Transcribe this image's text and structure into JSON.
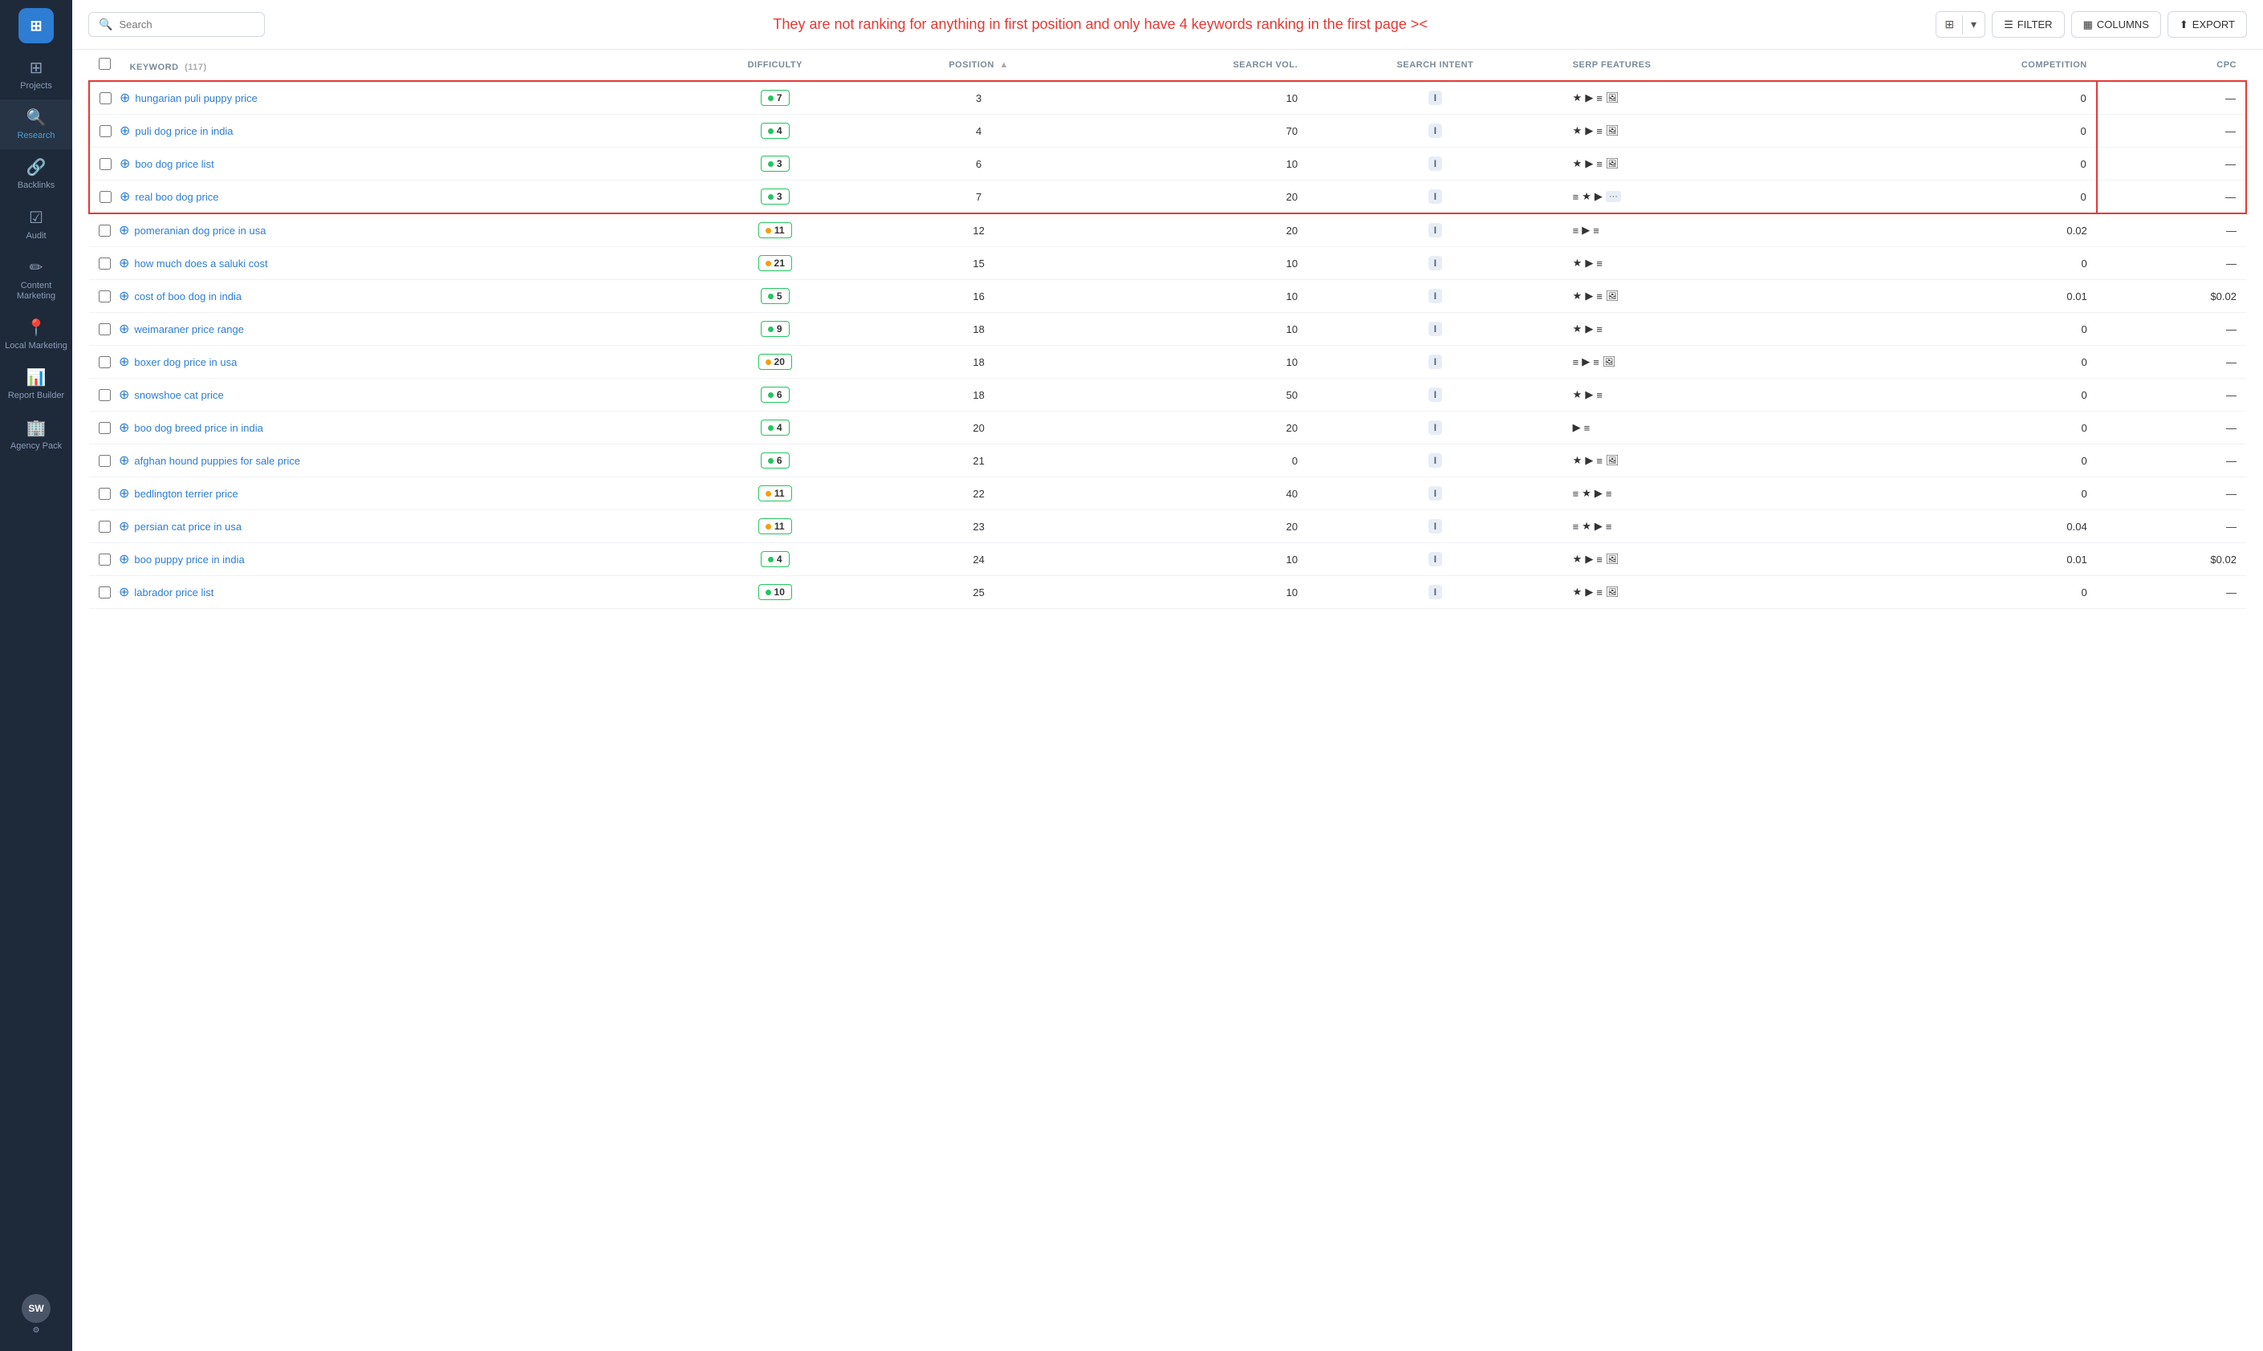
{
  "sidebar": {
    "logo": "⊞",
    "items": [
      {
        "id": "projects",
        "label": "Projects",
        "icon": "⊞",
        "active": false
      },
      {
        "id": "research",
        "label": "Research",
        "icon": "🔍",
        "active": true
      },
      {
        "id": "backlinks",
        "label": "Backlinks",
        "icon": "🔗",
        "active": false
      },
      {
        "id": "audit",
        "label": "Audit",
        "icon": "☑",
        "active": false
      },
      {
        "id": "content-marketing",
        "label": "Content Marketing",
        "icon": "✏",
        "active": false
      },
      {
        "id": "local-marketing",
        "label": "Local Marketing",
        "icon": "📍",
        "active": false
      },
      {
        "id": "report-builder",
        "label": "Report Builder",
        "icon": "📊",
        "active": false
      },
      {
        "id": "agency-pack",
        "label": "Agency Pack",
        "icon": "🏢",
        "active": false
      }
    ],
    "avatar": "SW"
  },
  "toolbar": {
    "search_placeholder": "Search",
    "annotation": "They are not ranking for anything in first position and only have 4 keywords ranking in the first page ><",
    "filter_label": "FILTER",
    "columns_label": "COLUMNS",
    "export_label": "EXPORT"
  },
  "table": {
    "header": {
      "select_all": "",
      "keyword_col": "KEYWORD",
      "keyword_count": "117",
      "difficulty_col": "DIFFICULTY",
      "position_col": "POSITION",
      "search_vol_col": "SEARCH VOL.",
      "search_intent_col": "SEARCH INTENT",
      "serp_features_col": "SERP FEATURES",
      "competition_col": "COMPETITION",
      "cpc_col": "CPC"
    },
    "rows": [
      {
        "id": 1,
        "keyword": "hungarian puli puppy price",
        "difficulty": 7,
        "diff_color": "green",
        "position": 3,
        "search_vol": 10,
        "intent": "I",
        "serp": [
          "★",
          "▶",
          "≡",
          "🖼"
        ],
        "competition": 0,
        "cpc": "—",
        "highlighted": true
      },
      {
        "id": 2,
        "keyword": "puli dog price in india",
        "difficulty": 4,
        "diff_color": "green",
        "position": 4,
        "search_vol": 70,
        "intent": "I",
        "serp": [
          "★",
          "▶",
          "≡",
          "🖼"
        ],
        "competition": 0,
        "cpc": "—",
        "highlighted": true
      },
      {
        "id": 3,
        "keyword": "boo dog price list",
        "difficulty": 3,
        "diff_color": "green",
        "position": 6,
        "search_vol": 10,
        "intent": "I",
        "serp": [
          "★",
          "▶",
          "≡",
          "🖼"
        ],
        "competition": 0,
        "cpc": "—",
        "highlighted": true
      },
      {
        "id": 4,
        "keyword": "real boo dog price",
        "difficulty": 3,
        "diff_color": "green",
        "position": 7,
        "search_vol": 20,
        "intent": "I",
        "serp": [
          "≡",
          "★",
          "▶",
          "···"
        ],
        "competition": 0,
        "cpc": "—",
        "highlighted": true
      },
      {
        "id": 5,
        "keyword": "pomeranian dog price in usa",
        "difficulty": 11,
        "diff_color": "green",
        "position": 12,
        "search_vol": 20,
        "intent": "I",
        "serp": [
          "≡",
          "▶",
          "≡"
        ],
        "competition": 0.02,
        "cpc": "—",
        "highlighted": false
      },
      {
        "id": 6,
        "keyword": "how much does a saluki cost",
        "difficulty": 21,
        "diff_color": "yellow",
        "position": 15,
        "search_vol": 10,
        "intent": "I",
        "serp": [
          "★",
          "▶",
          "≡"
        ],
        "competition": 0,
        "cpc": "—",
        "highlighted": false
      },
      {
        "id": 7,
        "keyword": "cost of boo dog in india",
        "difficulty": 5,
        "diff_color": "green",
        "position": 16,
        "search_vol": 10,
        "intent": "I",
        "serp": [
          "★",
          "▶",
          "≡",
          "🖼"
        ],
        "competition": 0.01,
        "cpc": "$0.02",
        "highlighted": false
      },
      {
        "id": 8,
        "keyword": "weimaraner price range",
        "difficulty": 9,
        "diff_color": "green",
        "position": 18,
        "search_vol": 10,
        "intent": "I",
        "serp": [
          "★",
          "▶",
          "≡"
        ],
        "competition": 0,
        "cpc": "—",
        "highlighted": false
      },
      {
        "id": 9,
        "keyword": "boxer dog price in usa",
        "difficulty": 20,
        "diff_color": "yellow",
        "position": 18,
        "search_vol": 10,
        "intent": "I",
        "serp": [
          "≡",
          "▶",
          "≡",
          "🖼"
        ],
        "competition": 0,
        "cpc": "—",
        "highlighted": false
      },
      {
        "id": 10,
        "keyword": "snowshoe cat price",
        "difficulty": 6,
        "diff_color": "green",
        "position": 18,
        "search_vol": 50,
        "intent": "I",
        "serp": [
          "★",
          "▶",
          "≡"
        ],
        "competition": 0,
        "cpc": "—",
        "highlighted": false
      },
      {
        "id": 11,
        "keyword": "boo dog breed price in india",
        "difficulty": 4,
        "diff_color": "green",
        "position": 20,
        "search_vol": 20,
        "intent": "I",
        "serp": [
          "▶",
          "≡"
        ],
        "competition": 0,
        "cpc": "—",
        "highlighted": false
      },
      {
        "id": 12,
        "keyword": "afghan hound puppies for sale price",
        "difficulty": 6,
        "diff_color": "green",
        "position": 21,
        "search_vol": 0,
        "intent": "I",
        "serp": [
          "★",
          "▶",
          "≡",
          "🖼"
        ],
        "competition": 0,
        "cpc": "—",
        "highlighted": false
      },
      {
        "id": 13,
        "keyword": "bedlington terrier price",
        "difficulty": 11,
        "diff_color": "green",
        "position": 22,
        "search_vol": 40,
        "intent": "I",
        "serp": [
          "≡",
          "★",
          "▶",
          "≡"
        ],
        "competition": 0,
        "cpc": "—",
        "highlighted": false
      },
      {
        "id": 14,
        "keyword": "persian cat price in usa",
        "difficulty": 11,
        "diff_color": "green",
        "position": 23,
        "search_vol": 20,
        "intent": "I",
        "serp": [
          "≡",
          "★",
          "▶",
          "≡"
        ],
        "competition": 0.04,
        "cpc": "—",
        "highlighted": false
      },
      {
        "id": 15,
        "keyword": "boo puppy price in india",
        "difficulty": 4,
        "diff_color": "green",
        "position": 24,
        "search_vol": 10,
        "intent": "I",
        "serp": [
          "★",
          "▶",
          "≡",
          "🖼"
        ],
        "competition": 0.01,
        "cpc": "$0.02",
        "highlighted": false
      },
      {
        "id": 16,
        "keyword": "labrador price list",
        "difficulty": 10,
        "diff_color": "green",
        "position": 25,
        "search_vol": 10,
        "intent": "I",
        "serp": [
          "★",
          "▶",
          "≡",
          "🖼"
        ],
        "competition": 0,
        "cpc": "—",
        "highlighted": false
      }
    ]
  }
}
